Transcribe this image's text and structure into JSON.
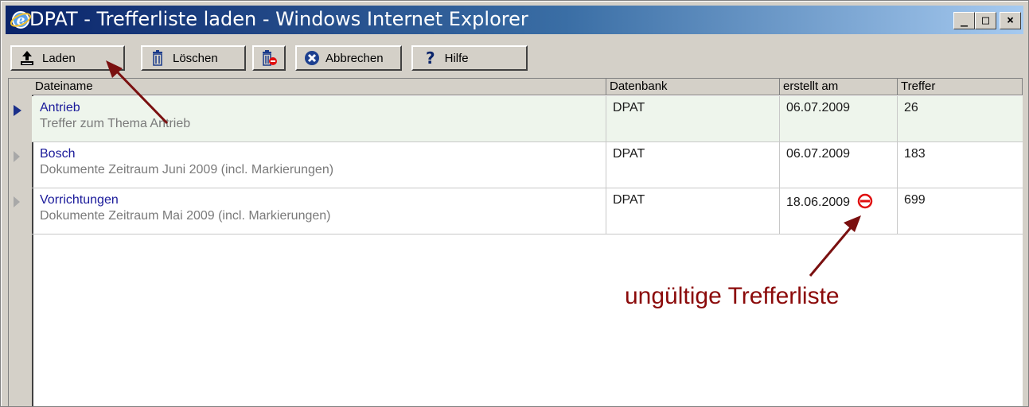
{
  "window": {
    "title": "DPAT - Trefferliste laden - Windows Internet Explorer",
    "controls": {
      "minimize": "_",
      "maximize": "□",
      "close": "×"
    }
  },
  "toolbar": {
    "load_label": "Laden",
    "delete_label": "Löschen",
    "cancel_label": "Abbrechen",
    "help_label": "Hilfe",
    "help_symbol": "?"
  },
  "table": {
    "columns": [
      "Dateiname",
      "Datenbank",
      "erstellt am",
      "Treffer"
    ],
    "rows": [
      {
        "name": "Antrieb",
        "description": "Treffer zum Thema Antrieb",
        "database": "DPAT",
        "created": "06.07.2009",
        "hits": "26",
        "selected": true,
        "invalid": false
      },
      {
        "name": "Bosch",
        "description": "Dokumente Zeitraum Juni 2009 (incl. Markierungen)",
        "database": "DPAT",
        "created": "06.07.2009",
        "hits": "183",
        "selected": false,
        "invalid": false
      },
      {
        "name": "Vorrichtungen",
        "description": "Dokumente Zeitraum Mai 2009 (incl. Markierungen)",
        "database": "DPAT",
        "created": "18.06.2009",
        "hits": "699",
        "selected": false,
        "invalid": true
      }
    ]
  },
  "annotation": {
    "text": "ungültige Trefferliste"
  },
  "colors": {
    "annotation": "#8b0a0a",
    "invalid_icon": "#e01010",
    "row_link": "#1a1a9a",
    "selected_row": "#eef5ec"
  }
}
